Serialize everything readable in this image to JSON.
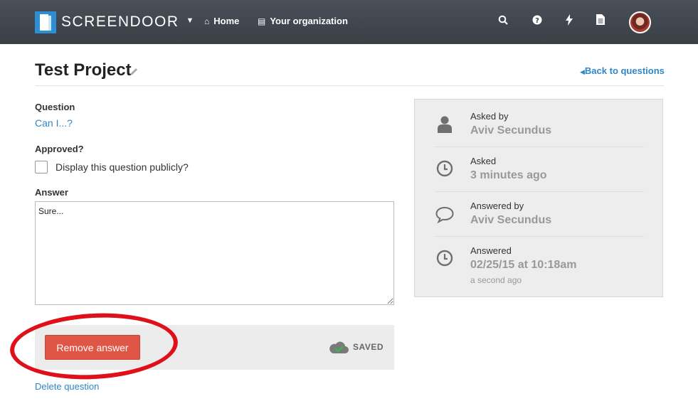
{
  "app": {
    "logo_text": "SCREENDOOR",
    "nav": [
      {
        "icon": "home-icon",
        "label": "Home"
      },
      {
        "icon": "building-icon",
        "label": "Your organization"
      }
    ],
    "right_icons": [
      "search-icon",
      "help-icon",
      "lightning-icon",
      "document-icon"
    ]
  },
  "header": {
    "title": "Test Project",
    "back_link": "Back to questions"
  },
  "form": {
    "question_label": "Question",
    "question_value": "Can I...?",
    "approved_label": "Approved?",
    "approved_checkbox_label": "Display this question publicly?",
    "answer_label": "Answer",
    "answer_value": "Sure...",
    "remove_button": "Remove answer",
    "saved_status": "SAVED",
    "delete_link": "Delete question"
  },
  "details": [
    {
      "icon": "user-icon",
      "label": "Asked by",
      "value": "Aviv Secundus"
    },
    {
      "icon": "clock-icon",
      "label": "Asked",
      "value": "3 minutes ago"
    },
    {
      "icon": "speech-bubble-icon",
      "label": "Answered by",
      "value": "Aviv Secundus"
    },
    {
      "icon": "clock-icon",
      "label": "Answered",
      "value": "02/25/15 at 10:18am",
      "sub": "a second ago"
    }
  ],
  "colors": {
    "topbar": "#3f444b",
    "link": "#2e87c8",
    "danger_button": "#e05646",
    "annotation_circle": "#e0101a"
  }
}
